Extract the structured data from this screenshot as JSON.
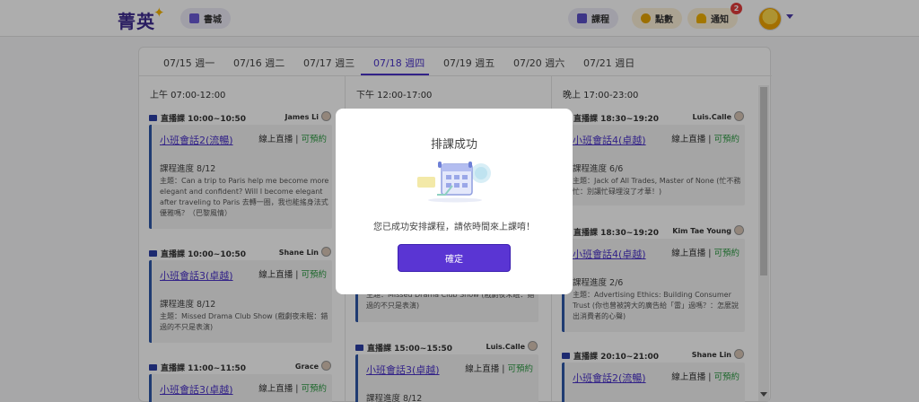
{
  "header": {
    "logo": "菁英",
    "bookstore_label": "書城",
    "course_label": "課程",
    "points_label": "點數",
    "notify_label": "通知",
    "notify_count": "2"
  },
  "tabs": [
    "07/15 週一",
    "07/16 週二",
    "07/17 週三",
    "07/18 週四",
    "07/19 週五",
    "07/20 週六",
    "07/21 週日"
  ],
  "active_tab": "07/18 週四",
  "columns": [
    {
      "title": "上午 07:00-12:00",
      "cards": [
        {
          "time": "直播課 10:00~10:50",
          "teacher": "James Li",
          "title": "小班會話2(流暢)",
          "mode": "線上直播",
          "avail": "可預約",
          "progress": "課程進度 8/12",
          "topic": "主題：Can a trip to Paris help me become more elegant and confident? Will I become elegant after traveling to Paris 去轉一圈，我也能搖身法式優雅嗎？（巴黎風情）"
        },
        {
          "time": "直播課 10:00~10:50",
          "teacher": "Shane Lin",
          "title": "小班會話3(卓越)",
          "mode": "線上直播",
          "avail": "可預約",
          "progress": "課程進度 8/12",
          "topic": "主題：Missed Drama Club Show (戲劇夜未眠：錯過的不只是表演)"
        },
        {
          "time": "直播課 11:00~11:50",
          "teacher": "Grace",
          "title": "小班會話3(卓越)",
          "mode": "線上直播",
          "avail": "可預約",
          "progress": "",
          "topic": ""
        }
      ]
    },
    {
      "title": "下午 12:00-17:00",
      "cards": [
        {
          "time": "",
          "teacher": "",
          "title": "",
          "mode": "",
          "avail": "",
          "progress": "",
          "topic": "主題：Missed Drama Club Show (戲劇夜未眠：錯過的不只是表演)"
        },
        {
          "time": "直播課 15:00~15:50",
          "teacher": "Luis.Calle",
          "title": "小班會話3(卓越)",
          "mode": "線上直播",
          "avail": "可預約",
          "progress": "課程進度 8/12",
          "topic": ""
        }
      ]
    },
    {
      "title": "晚上 17:00-23:00",
      "cards": [
        {
          "time": "直播課 18:30~19:20",
          "teacher": "Luis.Calle",
          "title": "小班會話4(卓越)",
          "mode": "線上直播",
          "avail": "可預約",
          "progress": "課程進度 6/6",
          "topic": "主題：Jack of All Trades, Master of None (忙不務忙：別讓忙碌埋沒了才華！)"
        },
        {
          "time": "直播課 18:30~19:20",
          "teacher": "Kim Tae Young",
          "title": "小班會話4(卓越)",
          "mode": "線上直播",
          "avail": "可預約",
          "progress": "課程進度 2/6",
          "topic": "主題：Advertising Ethics: Building Consumer Trust (你也曾被誇大的廣告給「雷」過嗎？：怎麼說出消費者的心聲)"
        },
        {
          "time": "直播課 20:10~21:00",
          "teacher": "Shane Lin",
          "title": "小班會話2(流暢)",
          "mode": "線上直播",
          "avail": "可預約",
          "progress": "",
          "topic": ""
        }
      ]
    }
  ],
  "modal": {
    "title": "排課成功",
    "message": "您已成功安排課程，請依時間來上課唷！",
    "confirm": "確定"
  },
  "colors": {
    "brand": "#4b33c9",
    "button": "#5a35d3",
    "available": "#2d9a43",
    "accent_bar": "#2e58a8"
  }
}
